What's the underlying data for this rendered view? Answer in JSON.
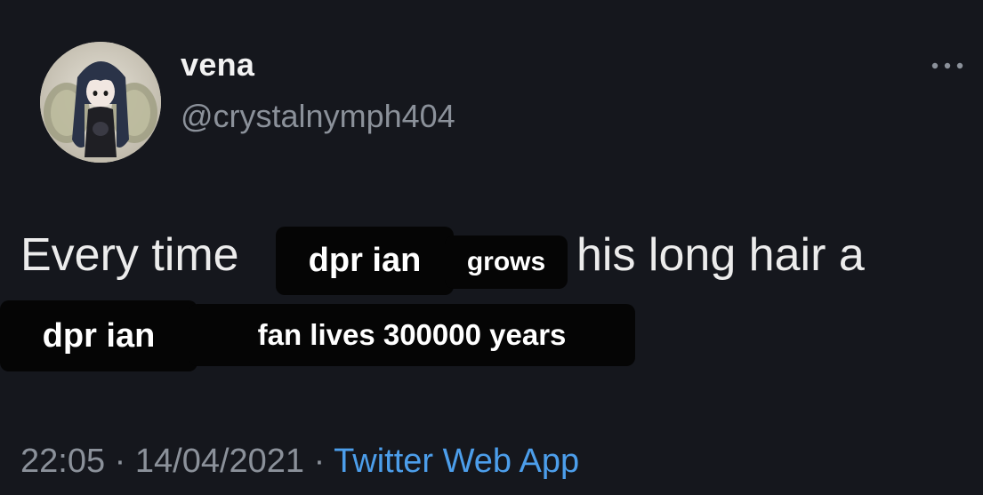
{
  "tweet": {
    "display_name": "vena",
    "handle": "@crystalnymph404",
    "text_before": "Every time",
    "text_after": "his long hair a",
    "stickers": {
      "name_1": "dpr ian",
      "grows": "grows",
      "name_2": "dpr ian",
      "fan_line": "fan lives 300000 years"
    },
    "time": "22:05",
    "separator": " · ",
    "date": "14/04/2021",
    "source": "Twitter Web App"
  },
  "icons": {
    "more": "more-horizontal-icon",
    "avatar": "fairy-avatar"
  },
  "colors": {
    "background": "#15171d",
    "text": "#ececec",
    "muted": "#8b919a",
    "link": "#4c9eeb",
    "sticker": "#050505"
  }
}
